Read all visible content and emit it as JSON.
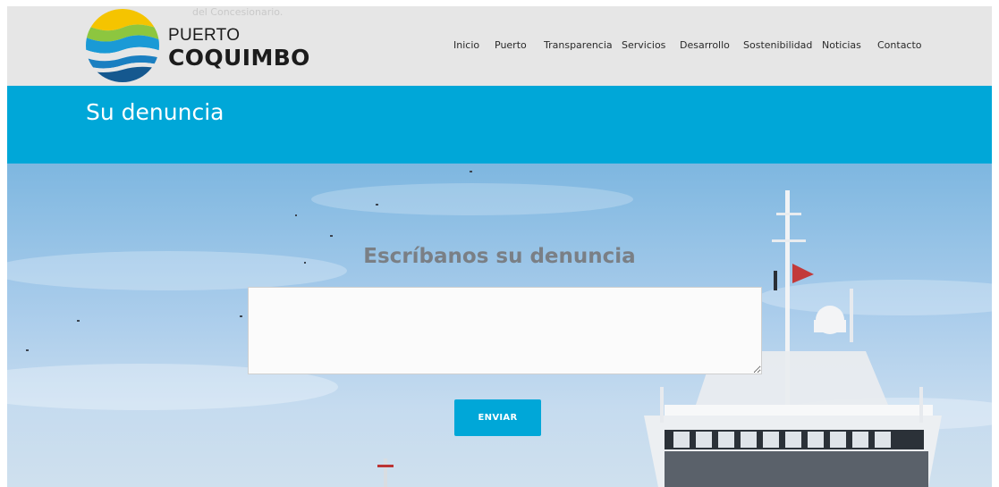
{
  "header": {
    "faded_text": "del Concesionario.",
    "logo": {
      "line1": "PUERTO",
      "line2": "COQUIMBO",
      "colors": {
        "yellow": "#f5c400",
        "green": "#8dc63f",
        "blue": "#1a7fc1",
        "dark_blue": "#15588f"
      }
    },
    "nav": [
      {
        "label": "Inicio"
      },
      {
        "label": "Puerto"
      },
      {
        "label": "Transparencia"
      },
      {
        "label": "Servicios"
      },
      {
        "label": "Desarrollo"
      },
      {
        "label": "Sostenibilidad"
      },
      {
        "label": "Noticias"
      },
      {
        "label": "Contacto"
      }
    ]
  },
  "title_bar": {
    "title": "Su denuncia",
    "color": "#00a7d8"
  },
  "form": {
    "heading": "Escríbanos su denuncia",
    "message_value": "",
    "submit_label": "ENVIAR",
    "button_color": "#00a7d8"
  }
}
